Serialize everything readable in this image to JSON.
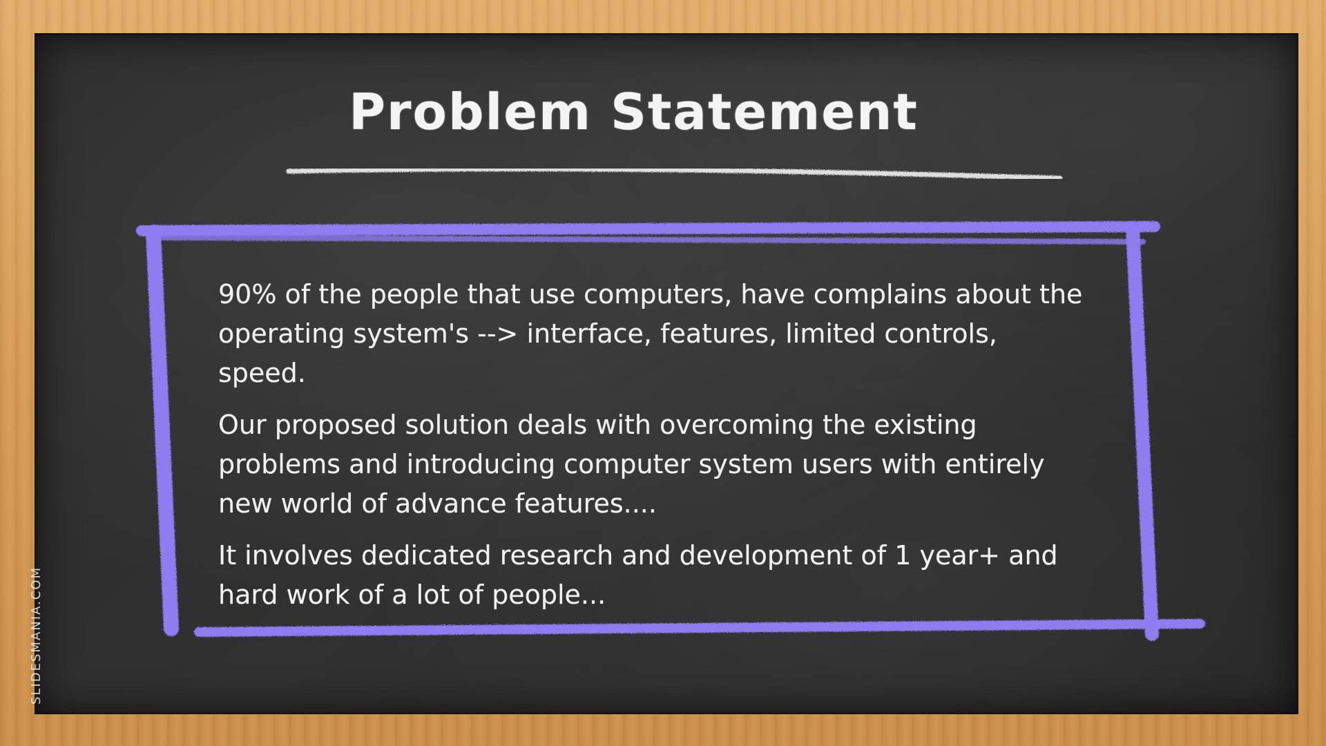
{
  "slide": {
    "title": "Problem Statement",
    "paragraphs": [
      "90% of the people that use computers, have complains about the operating system's --> interface, features, limited controls, speed.",
      "Our proposed solution deals with overcoming the existing problems and introducing computer system users with entirely new world of advance features....",
      "It involves dedicated research and development of 1 year+ and hard work of a lot of people..."
    ],
    "watermark": "SLIDESMANIA.COM"
  },
  "colors": {
    "frame_wood": "#d9a25f",
    "board": "#2b2b2b",
    "chalk_white": "#f4f4f4",
    "chalk_purple": "#8e7bf0"
  }
}
